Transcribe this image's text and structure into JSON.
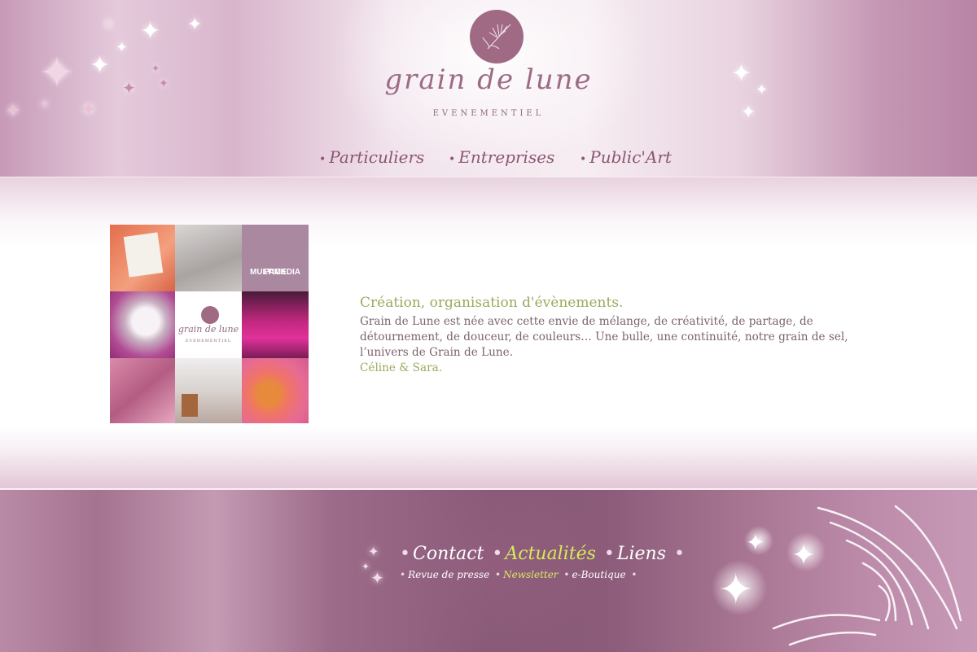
{
  "brand": {
    "name": "grain de lune",
    "tagline": "EVENEMENTIEL",
    "colors": {
      "accent_green": "#9aab5c",
      "text_mauve": "#7c6270",
      "logo_purple": "#a06a85",
      "active_link": "#d7ea5a"
    }
  },
  "main_nav": [
    {
      "label": "Particuliers"
    },
    {
      "label": "Entreprises"
    },
    {
      "label": "Public'Art"
    }
  ],
  "mosaic": {
    "pack_label_line1": "PACK",
    "pack_label_line2": "MULTIMEDIA",
    "mini_logo_name": "grain de lune",
    "mini_logo_tagline": "EVENEMENTIEL"
  },
  "intro": {
    "heading": "Création, organisation d'évènements.",
    "body": "Grain de Lune est née avec cette envie de mélange, de créativité, de partage, de détournement, de douceur, de couleurs… Une bulle, une continuité, notre grain de sel, l’univers de Grain de Lune.",
    "signature": "Céline & Sara."
  },
  "footer_nav": {
    "primary": [
      {
        "label": "Contact",
        "active": false
      },
      {
        "label": "Actualités",
        "active": true
      },
      {
        "label": "Liens",
        "active": false
      }
    ],
    "secondary": [
      {
        "label": "Revue de presse",
        "active": false
      },
      {
        "label": "Newsletter",
        "active": true
      },
      {
        "label": "e-Boutique",
        "active": false
      }
    ]
  },
  "icons": [
    "sparkle-star-icon",
    "dandelion-logo-icon",
    "light-burst-icon",
    "bullet-dot-icon"
  ]
}
